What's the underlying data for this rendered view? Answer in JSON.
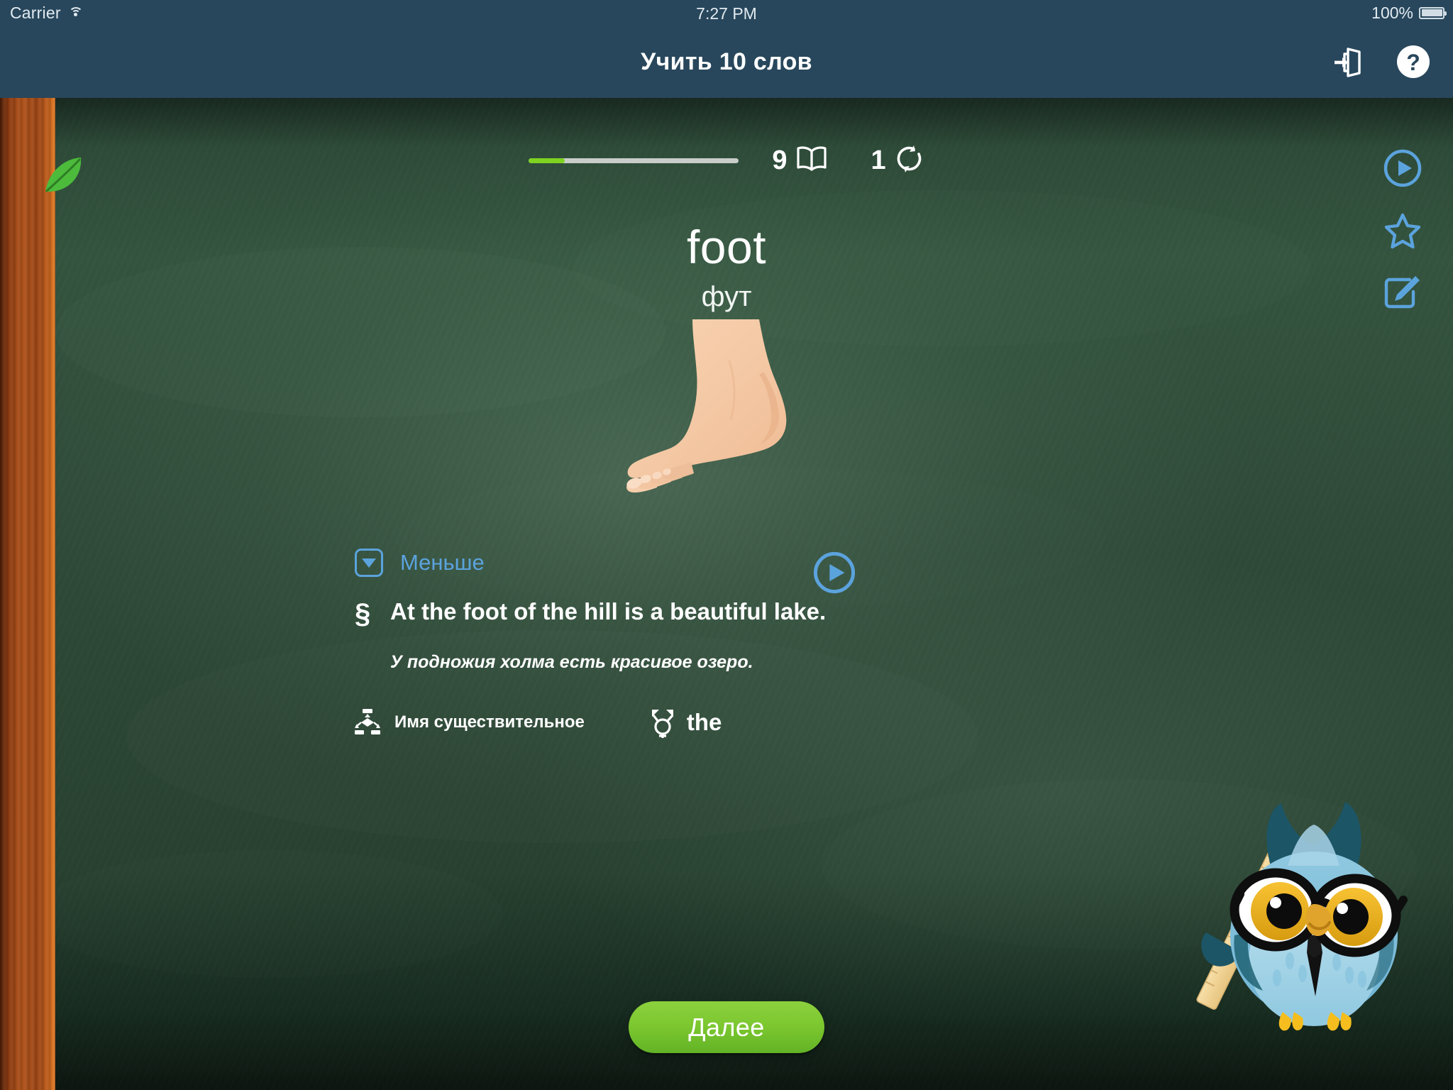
{
  "status_bar": {
    "carrier": "Carrier",
    "wifi_icon": "wifi-icon",
    "time": "7:27 PM",
    "battery_percent": "100%",
    "battery_icon": "battery-full-icon"
  },
  "nav_bar": {
    "title": "Учить 10 слов",
    "exit_icon": "exit-door-icon",
    "help_icon": "question-mark-circle-icon"
  },
  "lesson": {
    "progress_percent": 17,
    "learn_count": "9",
    "learn_icon": "open-book-icon",
    "repeat_count": "1",
    "repeat_icon": "refresh-loop-icon",
    "leaf_icon": "leaf-icon"
  },
  "card": {
    "word": "foot",
    "transcription": "фут",
    "image_icon": "foot-illustration",
    "play_word_icon": "play-circle-icon",
    "favorite_icon": "star-outline-icon",
    "edit_icon": "edit-pencil-square-icon"
  },
  "details": {
    "toggle_label": "Меньше",
    "toggle_icon": "chevron-down-box-icon",
    "example_marker": "§",
    "example_en": "At the foot of the hill is a beautiful lake.",
    "example_ru": "У подножия холма есть красивое озеро.",
    "play_example_icon": "play-circle-icon",
    "part_of_speech_icon": "hierarchy-icon",
    "part_of_speech": "Имя существительное",
    "article_icon": "gender-symbol-icon",
    "article": "the"
  },
  "footer": {
    "next_label": "Далее"
  },
  "mascot": {
    "owl_icon": "owl-teacher-icon"
  },
  "colors": {
    "nav_background": "#28475C",
    "board_green": "#2E4A38",
    "wood_frame": "#9D4617",
    "accent_blue": "#5BA3DD",
    "accent_green": "#7ED321",
    "next_button_green": "#7CC72F",
    "text_white": "#FFFFFF"
  }
}
